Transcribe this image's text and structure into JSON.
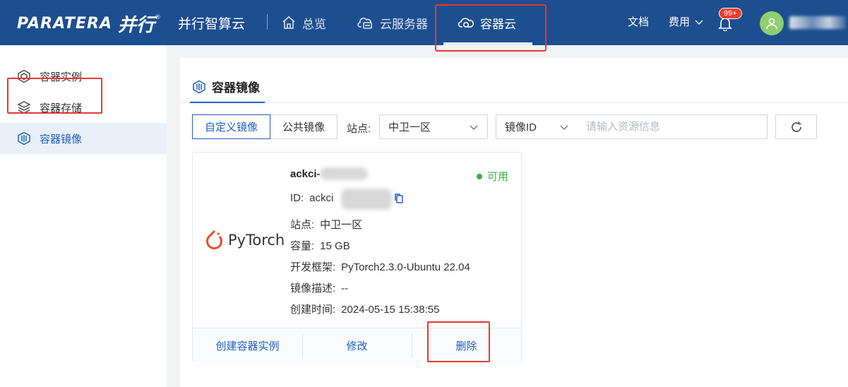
{
  "header": {
    "logo_en": "PARATERA",
    "logo_cn": "并行",
    "logo_reg": "®",
    "brand": "并行智算云",
    "nav": [
      {
        "label": "总览",
        "icon": "home-icon"
      },
      {
        "label": "云服务器",
        "icon": "cloud-server-icon"
      },
      {
        "label": "容器云",
        "icon": "container-cloud-icon",
        "active": true
      }
    ],
    "docs": "文档",
    "fees": "费用",
    "notifications_badge": "99+"
  },
  "sidebar": {
    "items": [
      {
        "label": "容器实例",
        "icon": "container-instance-icon"
      },
      {
        "label": "容器存储",
        "icon": "layers-icon"
      },
      {
        "label": "容器镜像",
        "icon": "container-image-icon",
        "active": true
      }
    ]
  },
  "main": {
    "title": "容器镜像",
    "tabs": [
      {
        "label": "自定义镜像",
        "active": true
      },
      {
        "label": "公共镜像"
      }
    ],
    "site_label": "站点:",
    "site_select": "中卫一区",
    "filter_select": "镜像ID",
    "search_placeholder": "请输入资源信息"
  },
  "card": {
    "logo_text": "PyTorch",
    "name": "ackci-",
    "status": "可用",
    "id_label": "ID:",
    "id_value": "ackci",
    "site_label": "站点:",
    "site_value": "中卫一区",
    "capacity_label": "容量:",
    "capacity_value": "15 GB",
    "framework_label": "开发框架:",
    "framework_value": "PyTorch2.3.0-Ubuntu 22.04",
    "desc_label": "镜像描述:",
    "desc_value": "--",
    "created_label": "创建时间:",
    "created_value": "2024-05-15 15:38:55",
    "actions": [
      "创建容器实例",
      "修改",
      "删除"
    ]
  },
  "colors": {
    "topbar": "#1d4e8f",
    "accent": "#1f5fbf",
    "status_ok": "#2fb344",
    "highlight": "#e53935",
    "badge": "#ef3b2e"
  }
}
